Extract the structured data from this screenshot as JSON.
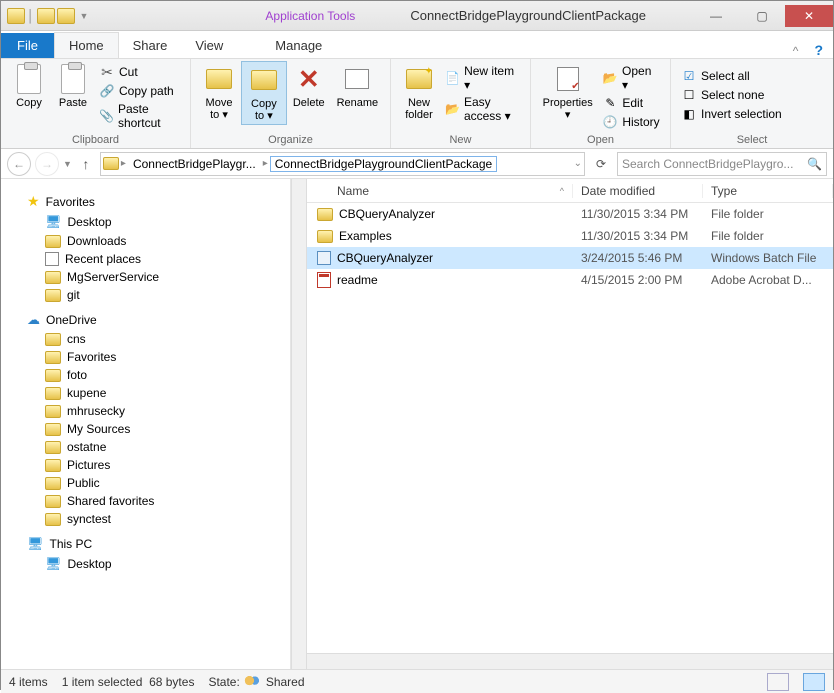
{
  "window": {
    "title": "ConnectBridgePlaygroundClientPackage",
    "tool_category": "Application Tools"
  },
  "tabs": {
    "file": "File",
    "home": "Home",
    "share": "Share",
    "view": "View",
    "manage": "Manage"
  },
  "ribbon": {
    "clipboard": {
      "label": "Clipboard",
      "copy": "Copy",
      "paste": "Paste",
      "cut": "Cut",
      "copy_path": "Copy path",
      "paste_shortcut": "Paste shortcut"
    },
    "organize": {
      "label": "Organize",
      "move_to": "Move\nto ▾",
      "copy_to": "Copy\nto ▾",
      "delete": "Delete",
      "rename": "Rename"
    },
    "new": {
      "label": "New",
      "new_folder": "New\nfolder",
      "new_item": "New item ▾",
      "easy_access": "Easy access ▾"
    },
    "open": {
      "label": "Open",
      "properties": "Properties\n▾",
      "open": "Open ▾",
      "edit": "Edit",
      "history": "History"
    },
    "select": {
      "label": "Select",
      "select_all": "Select all",
      "select_none": "Select none",
      "invert": "Invert selection"
    }
  },
  "breadcrumb": {
    "seg1": "ConnectBridgePlaygr...",
    "seg2": "ConnectBridgePlaygroundClientPackage"
  },
  "search": {
    "placeholder": "Search ConnectBridgePlaygro..."
  },
  "tree": {
    "favorites": "Favorites",
    "fav_items": [
      "Desktop",
      "Downloads",
      "Recent places",
      "MgServerService",
      "git"
    ],
    "onedrive": "OneDrive",
    "od_items": [
      "cns",
      "Favorites",
      "foto",
      "kupene",
      "mhrusecky",
      "My Sources",
      "ostatne",
      "Pictures",
      "Public",
      "Shared favorites",
      "synctest"
    ],
    "thispc": "This PC",
    "pc_items": [
      "Desktop"
    ]
  },
  "columns": {
    "name": "Name",
    "date": "Date modified",
    "type": "Type"
  },
  "files": [
    {
      "name": "CBQueryAnalyzer",
      "date": "11/30/2015 3:34 PM",
      "type": "File folder",
      "kind": "folder"
    },
    {
      "name": "Examples",
      "date": "11/30/2015 3:34 PM",
      "type": "File folder",
      "kind": "folder"
    },
    {
      "name": "CBQueryAnalyzer",
      "date": "3/24/2015 5:46 PM",
      "type": "Windows Batch File",
      "kind": "bat",
      "selected": true
    },
    {
      "name": "readme",
      "date": "4/15/2015 2:00 PM",
      "type": "Adobe Acrobat D...",
      "kind": "pdf"
    }
  ],
  "status": {
    "items": "4 items",
    "selected": "1 item selected",
    "size": "68 bytes",
    "state_label": "State:",
    "state_value": "Shared"
  }
}
